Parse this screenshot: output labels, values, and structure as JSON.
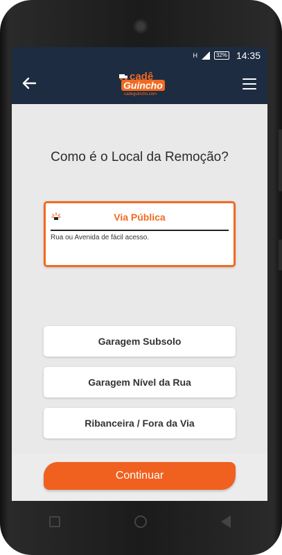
{
  "status_bar": {
    "network": "H",
    "battery": "32%",
    "time": "14:35"
  },
  "app_bar": {
    "logo_top": "cadê",
    "logo_mid": "Guincho",
    "logo_url": "cadeguincho.com",
    "back_icon": "arrow-left-icon",
    "menu_icon": "hamburger-menu-icon"
  },
  "page": {
    "title": "Como é o Local da Remoção?"
  },
  "options": [
    {
      "label": "Via Pública",
      "description": "Rua ou Avenida de fácil acesso.",
      "selected": true
    },
    {
      "label": "Garagem Subsolo",
      "selected": false
    },
    {
      "label": "Garagem Nível da Rua",
      "selected": false
    },
    {
      "label": "Ribanceira / Fora da Via",
      "selected": false
    }
  ],
  "continue_label": "Continuar",
  "colors": {
    "primary_dark": "#1d2c40",
    "accent_orange": "#f26a21"
  }
}
